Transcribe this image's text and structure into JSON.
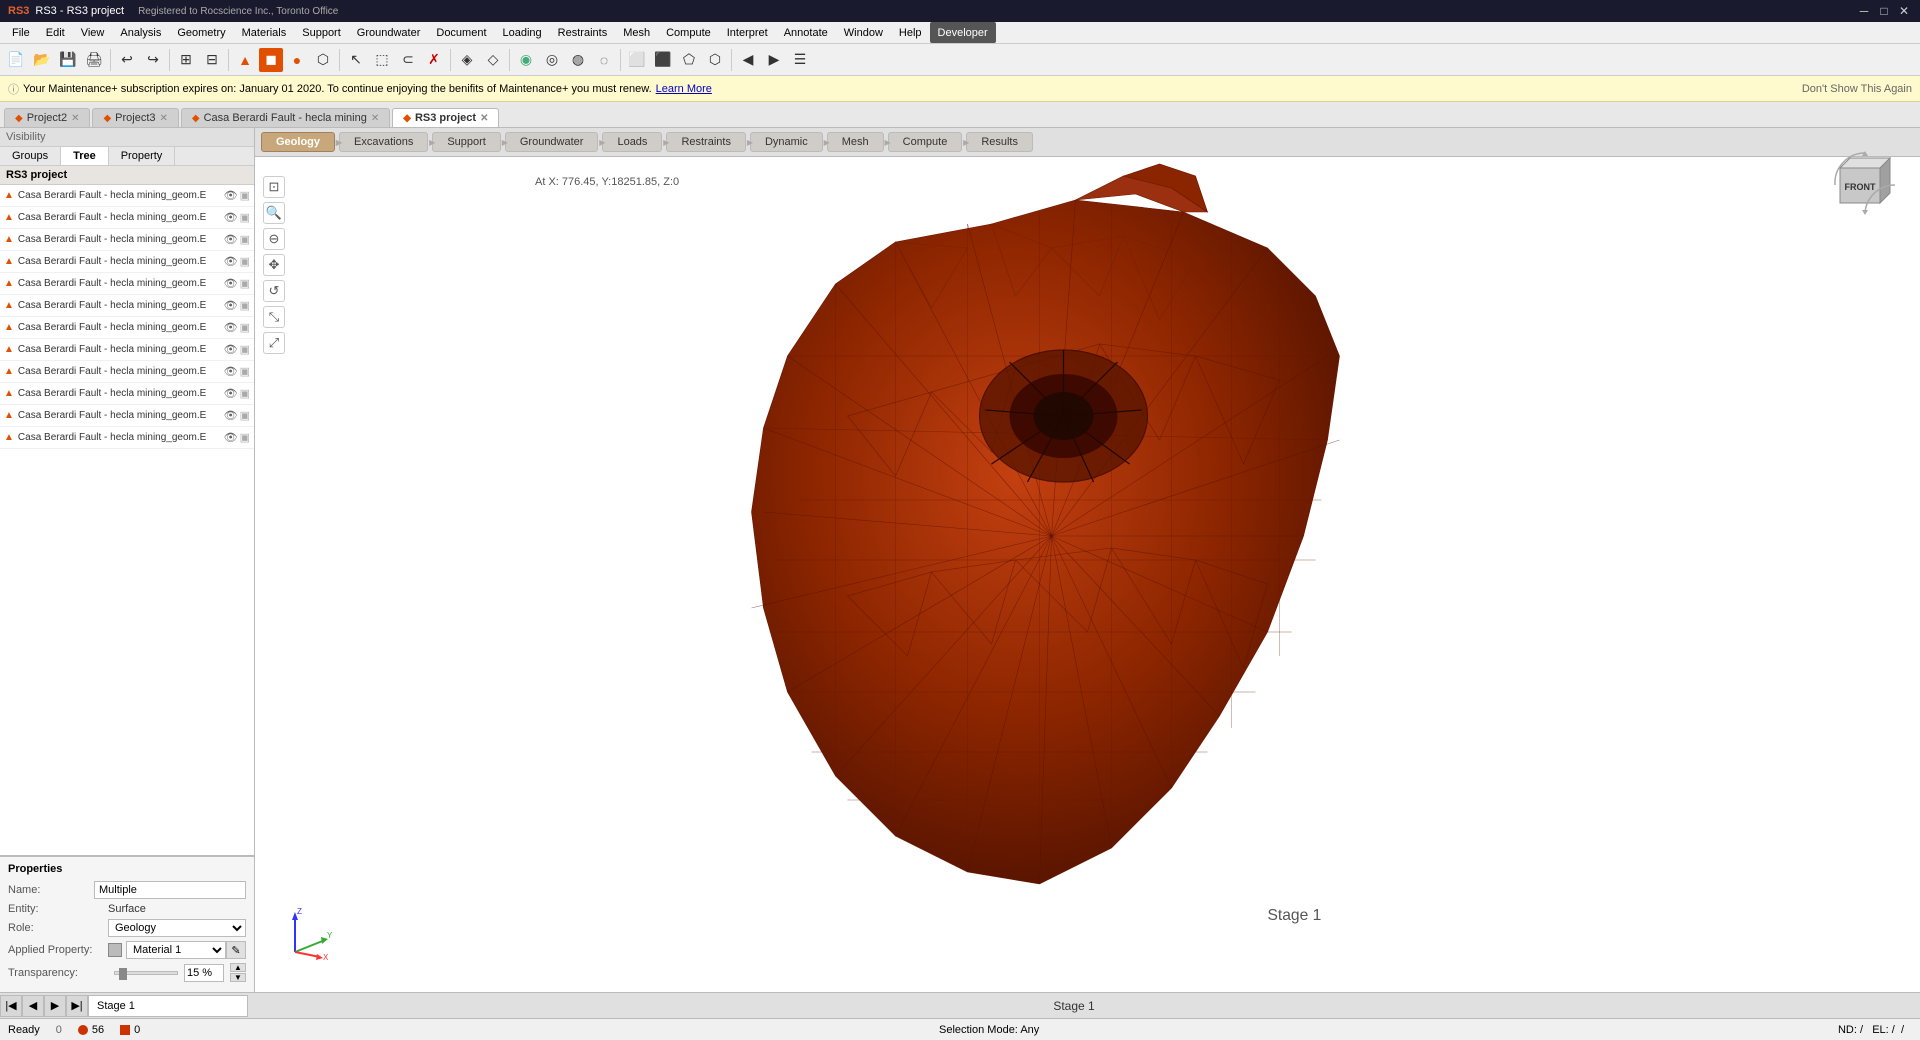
{
  "titlebar": {
    "title": "RS3 - RS3 project",
    "company": "Registered to Rocscience Inc., Toronto Office",
    "controls": [
      "─",
      "□",
      "✕"
    ]
  },
  "menubar": {
    "items": [
      "File",
      "Edit",
      "View",
      "Analysis",
      "Geometry",
      "Materials",
      "Support",
      "Groundwater",
      "Document",
      "Loading",
      "Restraints",
      "Mesh",
      "Compute",
      "Interpret",
      "Annotate",
      "Window",
      "Help",
      "Developer"
    ]
  },
  "notification": {
    "icon": "ⓘ",
    "text": "Your Maintenance+ subscription expires on: January 01 2020. To continue enjoying the benifits of Maintenance+ you must renew.",
    "link_text": "Learn More",
    "dismiss": "Don't Show This Again"
  },
  "tabs": [
    {
      "label": "Project2",
      "active": false,
      "icon": "◆",
      "closable": true
    },
    {
      "label": "Project3",
      "active": false,
      "icon": "◆",
      "closable": true
    },
    {
      "label": "Casa Berardi Fault - hecla mining",
      "active": false,
      "icon": "◆",
      "closable": true
    },
    {
      "label": "RS3 project",
      "active": true,
      "icon": "◆",
      "closable": true
    }
  ],
  "visibility": {
    "label": "Visibility",
    "tabs": [
      "Groups",
      "Tree",
      "Property"
    ],
    "active_tab": "Tree"
  },
  "tree": {
    "header": "RS3 project",
    "items": [
      "Casa Berardi Fault - hecla mining_geom.E",
      "Casa Berardi Fault - hecla mining_geom.E",
      "Casa Berardi Fault - hecla mining_geom.E",
      "Casa Berardi Fault - hecla mining_geom.E",
      "Casa Berardi Fault - hecla mining_geom.E",
      "Casa Berardi Fault - hecla mining_geom.E",
      "Casa Berardi Fault - hecla mining_geom.E",
      "Casa Berardi Fault - hecla mining_geom.E",
      "Casa Berardi Fault - hecla mining_geom.E",
      "Casa Berardi Fault - hecla mining_geom.E",
      "Casa Berardi Fault - hecla mining_geom.E",
      "Casa Berardi Fault - hecla mining_geom.E"
    ]
  },
  "properties": {
    "title": "Properties",
    "name_label": "Name:",
    "name_value": "Multiple",
    "entity_label": "Entity:",
    "entity_value": "Surface",
    "role_label": "Role:",
    "role_value": "Geology",
    "applied_label": "Applied Property:",
    "applied_value": "Material 1",
    "transparency_label": "Transparency:",
    "transparency_value": "15 %"
  },
  "workflow_tabs": [
    {
      "label": "Geology",
      "active": true
    },
    {
      "label": "Excavations",
      "active": false
    },
    {
      "label": "Support",
      "active": false
    },
    {
      "label": "Groundwater",
      "active": false
    },
    {
      "label": "Loads",
      "active": false
    },
    {
      "label": "Restraints",
      "active": false
    },
    {
      "label": "Dynamic",
      "active": false
    },
    {
      "label": "Mesh",
      "active": false
    },
    {
      "label": "Compute",
      "active": false
    },
    {
      "label": "Results",
      "active": false
    }
  ],
  "viewport": {
    "coord_text": "At X: 776.45, Y:18251.85, Z:0"
  },
  "stage": {
    "nav_buttons": [
      "|◀",
      "◀",
      "▶",
      "▶|"
    ],
    "name": "Stage 1",
    "center_label": "Stage 1"
  },
  "status_bar": {
    "ready": "Ready",
    "nd": "ND: /",
    "el": "EL: /",
    "count_tri": "56",
    "count_sq": "0",
    "count_other": "0",
    "selection_mode": "Selection Mode: Any"
  },
  "colors": {
    "mesh_fill": "#8B2500",
    "mesh_stroke": "#6B1500",
    "axis_x": "#ff3333",
    "axis_y": "#33aa33",
    "axis_z": "#3333ff"
  }
}
